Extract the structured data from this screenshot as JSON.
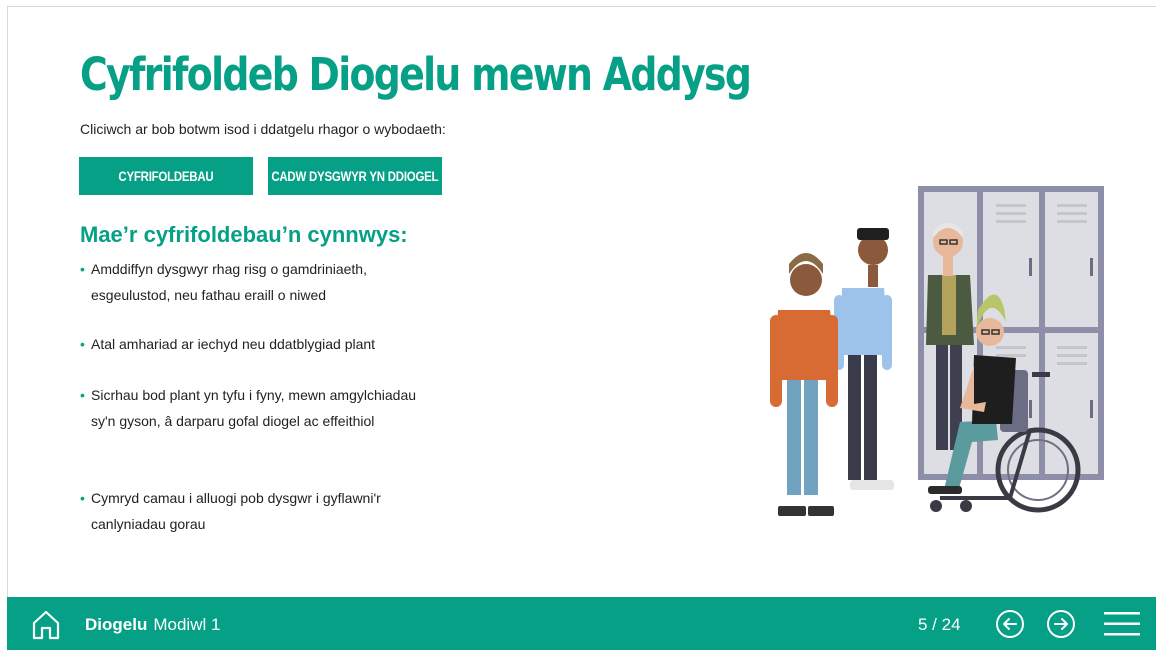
{
  "page": {
    "title": "Cyfrifoldeb Diogelu mewn Addysg",
    "intro": "Cliciwch ar bob botwm isod i ddatgelu rhagor o wybodaeth:"
  },
  "buttons": {
    "responsibilities": "CYFRIFOLDEBAU",
    "keep_safe": "CADW DYSGWYR YN DDIOGEL"
  },
  "content": {
    "heading": "Mae’r cyfrifoldebau’n cynnwys:",
    "bullets": [
      "Amddiffyn dysgwyr rhag risg o gamdriniaeth, esgeulustod, neu fathau eraill o niwed",
      "Atal amhariad ar iechyd neu ddatblygiad plant",
      "Sicrhau bod plant yn tyfu i fyny, mewn amgylchiadau sy'n gyson, â darparu gofal diogel ac effeithiol",
      "Cymryd camau i alluogi pob dysgwr i gyflawni'r canlyniadau gorau"
    ]
  },
  "footer": {
    "course_name": "Diogelu",
    "module": "Modiwl 1",
    "page_indicator": "5 / 24"
  },
  "icons": {
    "home": "home-icon",
    "prev": "arrow-left-circle-icon",
    "next": "arrow-right-circle-icon",
    "menu": "hamburger-menu-icon"
  },
  "colors": {
    "accent": "#05a085",
    "text": "#222222",
    "background": "#ffffff"
  }
}
